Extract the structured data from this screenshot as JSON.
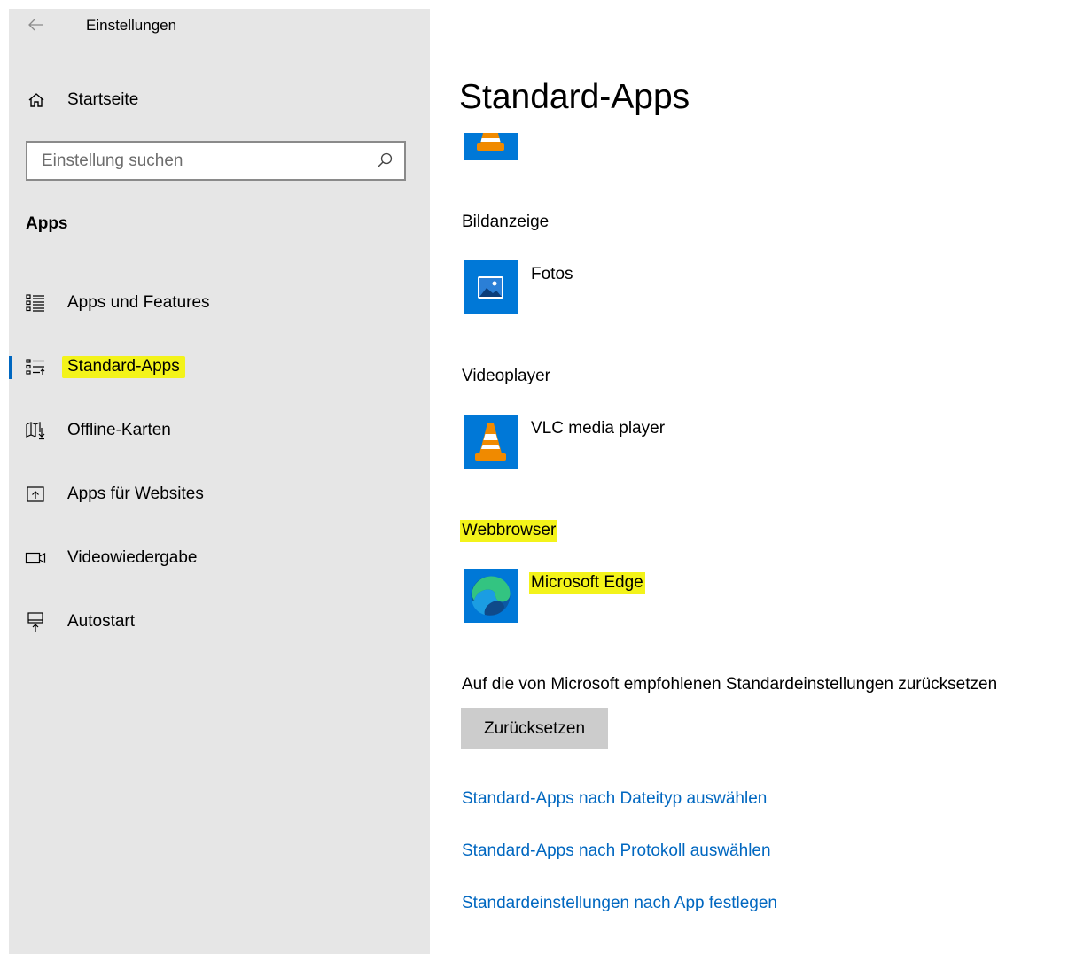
{
  "window": {
    "title": "Einstellungen"
  },
  "sidebar": {
    "home_label": "Startseite",
    "search": {
      "placeholder": "Einstellung suchen",
      "value": ""
    },
    "section_title": "Apps",
    "items": [
      {
        "label": "Apps und Features",
        "icon": "apps-features-icon"
      },
      {
        "label": "Standard-Apps",
        "icon": "default-apps-icon",
        "selected": true
      },
      {
        "label": "Offline-Karten",
        "icon": "offline-maps-icon"
      },
      {
        "label": "Apps für Websites",
        "icon": "apps-for-websites-icon"
      },
      {
        "label": "Videowiedergabe",
        "icon": "video-playback-icon"
      },
      {
        "label": "Autostart",
        "icon": "startup-icon"
      }
    ]
  },
  "main": {
    "title": "Standard-Apps",
    "defaults": [
      {
        "category": "Bildanzeige",
        "app": "Fotos",
        "icon": "photos-app-icon"
      },
      {
        "category": "Videoplayer",
        "app": "VLC media player",
        "icon": "vlc-app-icon"
      },
      {
        "category": "Webbrowser",
        "app": "Microsoft Edge",
        "icon": "edge-app-icon"
      }
    ],
    "reset": {
      "text": "Auf die von Microsoft empfohlenen Standardeinstellungen zurücksetzen",
      "button": "Zurücksetzen"
    },
    "links": [
      "Standard-Apps nach Dateityp auswählen",
      "Standard-Apps nach Protokoll auswählen",
      "Standardeinstellungen nach App festlegen"
    ]
  },
  "colors": {
    "sidebar_bg": "#e6e6e6",
    "accent": "#0067c0",
    "highlight": "#f3f31a",
    "tile_blue": "#0078d7",
    "button_bg": "#cccccc"
  }
}
